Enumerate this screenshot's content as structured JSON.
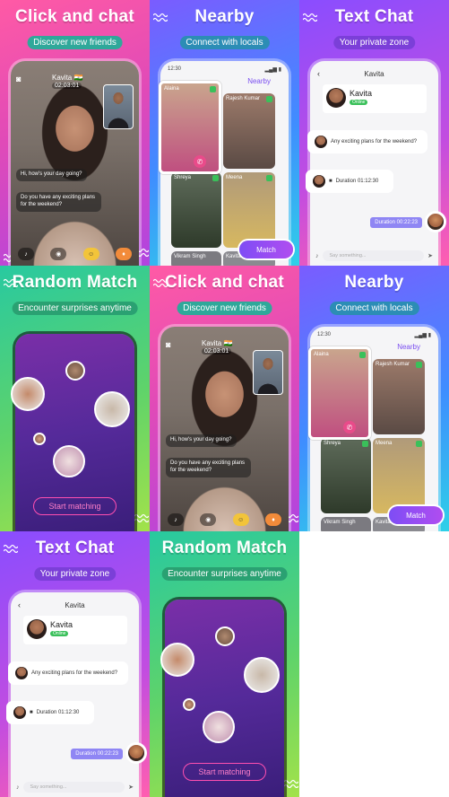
{
  "titles": {
    "click": "Click and chat",
    "click_sub": "Discover new friends",
    "nearby": "Nearby",
    "nearby_sub": "Connect with locals",
    "text": "Text Chat",
    "text_sub": "Your private zone",
    "random": "Random Match",
    "random_sub": "Encounter surprises anytime"
  },
  "call": {
    "name": "Kavita",
    "flag": "🇮🇳",
    "timer": "02:03:01",
    "msg1": "Hi, how's your day going?",
    "msg2": "Do you have any exciting plans for the weekend?"
  },
  "nearby": {
    "time": "12:30",
    "header": "Nearby",
    "people": [
      "Alaina",
      "Rajesh Kumar",
      "Shreya",
      "Meena",
      "Vikram Singh",
      "Kavita"
    ],
    "match": "Match"
  },
  "textchat": {
    "name": "Kavita",
    "online": "Online",
    "msg": "Any exciting plans for the weekend?",
    "duration_in": "Duration 01:12:30",
    "duration_out": "Duration 00:22:23",
    "placeholder": "Say something..."
  },
  "random": {
    "start": "Start matching"
  },
  "colors": {
    "pink_bg": "#e04ab8",
    "blue_bg": "#3f8dff",
    "purple_bg": "#c24de0",
    "green_bg": "#5fd36a",
    "accent": "#7e4df5"
  }
}
